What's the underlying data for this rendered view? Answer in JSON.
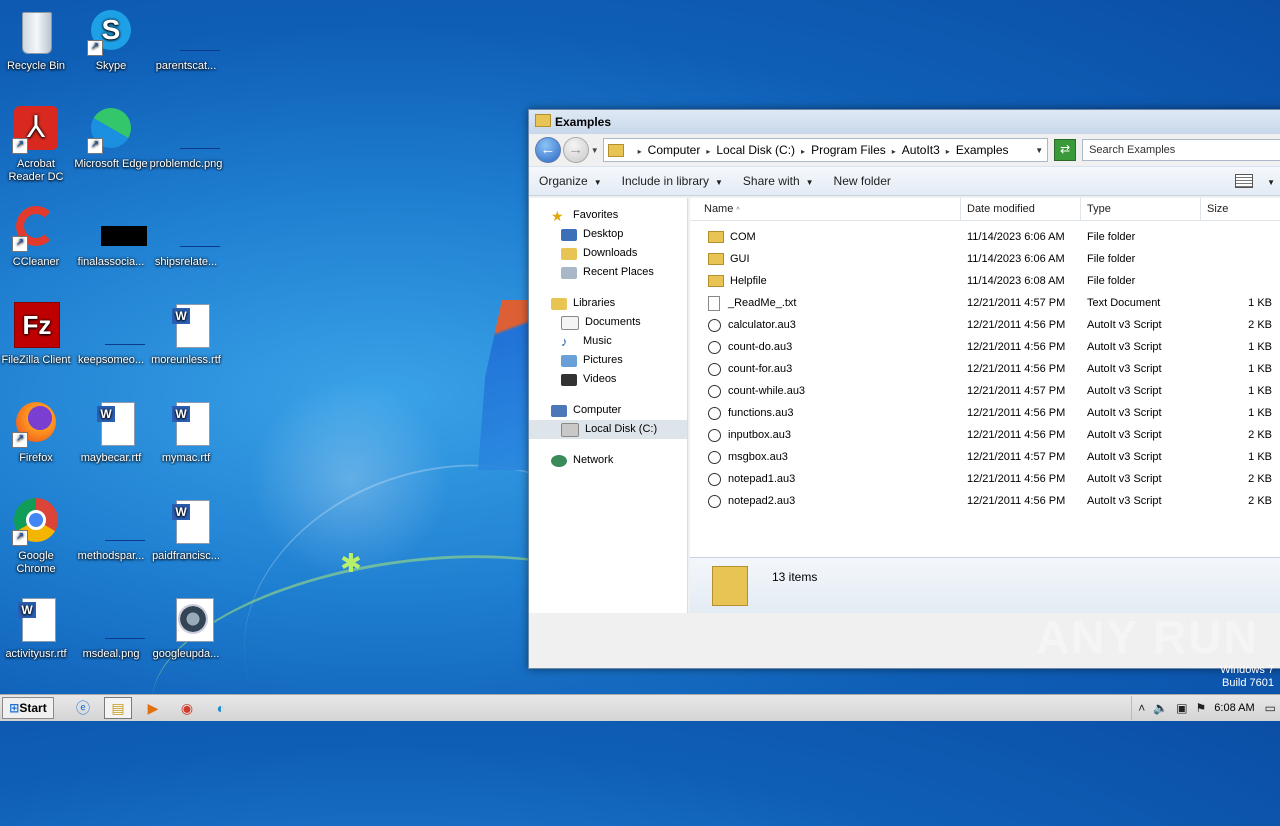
{
  "desktop": {
    "icons": [
      {
        "label": "Recycle Bin"
      },
      {
        "label": "Skype"
      },
      {
        "label": "parentscat..."
      },
      {
        "label": "Acrobat Reader DC"
      },
      {
        "label": "Microsoft Edge"
      },
      {
        "label": "problemdc.png"
      },
      {
        "label": "CCleaner"
      },
      {
        "label": "finalassocia..."
      },
      {
        "label": "shipsrelate..."
      },
      {
        "label": "FileZilla Client"
      },
      {
        "label": "keepsomeo..."
      },
      {
        "label": "moreunless.rtf"
      },
      {
        "label": "Firefox"
      },
      {
        "label": "maybecar.rtf"
      },
      {
        "label": "mymac.rtf"
      },
      {
        "label": "Google Chrome"
      },
      {
        "label": "methodspar..."
      },
      {
        "label": "paidfrancisc..."
      },
      {
        "label": "activityusr.rtf"
      },
      {
        "label": "msdeal.png"
      },
      {
        "label": "googleupda..."
      }
    ],
    "watermark": "ANY RUN",
    "build_line1": "Windows 7",
    "build_line2": "Build 7601"
  },
  "explorer": {
    "title": "Examples",
    "breadcrumb": [
      "Computer",
      "Local Disk (C:)",
      "Program Files",
      "AutoIt3",
      "Examples"
    ],
    "search_placeholder": "Search Examples",
    "toolbar": {
      "organize": "Organize",
      "include": "Include in library",
      "share": "Share with",
      "new_folder": "New folder"
    },
    "nav": {
      "favorites": "Favorites",
      "desktop": "Desktop",
      "downloads": "Downloads",
      "recent": "Recent Places",
      "libraries": "Libraries",
      "documents": "Documents",
      "music": "Music",
      "pictures": "Pictures",
      "videos": "Videos",
      "computer": "Computer",
      "local_disk": "Local Disk (C:)",
      "network": "Network"
    },
    "columns": {
      "name": "Name",
      "date": "Date modified",
      "type": "Type",
      "size": "Size"
    },
    "files": [
      {
        "name": "COM",
        "date": "11/14/2023 6:06 AM",
        "type": "File folder",
        "size": "",
        "icon": "folder-icon"
      },
      {
        "name": "GUI",
        "date": "11/14/2023 6:06 AM",
        "type": "File folder",
        "size": "",
        "icon": "folder-icon"
      },
      {
        "name": "Helpfile",
        "date": "11/14/2023 6:08 AM",
        "type": "File folder",
        "size": "",
        "icon": "folder-icon"
      },
      {
        "name": "_ReadMe_.txt",
        "date": "12/21/2011 4:57 PM",
        "type": "Text Document",
        "size": "1 KB",
        "icon": "text-file-icon"
      },
      {
        "name": "calculator.au3",
        "date": "12/21/2011 4:56 PM",
        "type": "AutoIt v3 Script",
        "size": "2 KB",
        "icon": "autoit-script-icon"
      },
      {
        "name": "count-do.au3",
        "date": "12/21/2011 4:56 PM",
        "type": "AutoIt v3 Script",
        "size": "1 KB",
        "icon": "autoit-script-icon"
      },
      {
        "name": "count-for.au3",
        "date": "12/21/2011 4:56 PM",
        "type": "AutoIt v3 Script",
        "size": "1 KB",
        "icon": "autoit-script-icon"
      },
      {
        "name": "count-while.au3",
        "date": "12/21/2011 4:57 PM",
        "type": "AutoIt v3 Script",
        "size": "1 KB",
        "icon": "autoit-script-icon"
      },
      {
        "name": "functions.au3",
        "date": "12/21/2011 4:56 PM",
        "type": "AutoIt v3 Script",
        "size": "1 KB",
        "icon": "autoit-script-icon"
      },
      {
        "name": "inputbox.au3",
        "date": "12/21/2011 4:56 PM",
        "type": "AutoIt v3 Script",
        "size": "2 KB",
        "icon": "autoit-script-icon"
      },
      {
        "name": "msgbox.au3",
        "date": "12/21/2011 4:57 PM",
        "type": "AutoIt v3 Script",
        "size": "1 KB",
        "icon": "autoit-script-icon"
      },
      {
        "name": "notepad1.au3",
        "date": "12/21/2011 4:56 PM",
        "type": "AutoIt v3 Script",
        "size": "2 KB",
        "icon": "autoit-script-icon"
      },
      {
        "name": "notepad2.au3",
        "date": "12/21/2011 4:56 PM",
        "type": "AutoIt v3 Script",
        "size": "2 KB",
        "icon": "autoit-script-icon"
      }
    ],
    "status": "13 items"
  },
  "taskbar": {
    "start": "Start",
    "clock": "6:08 AM"
  }
}
